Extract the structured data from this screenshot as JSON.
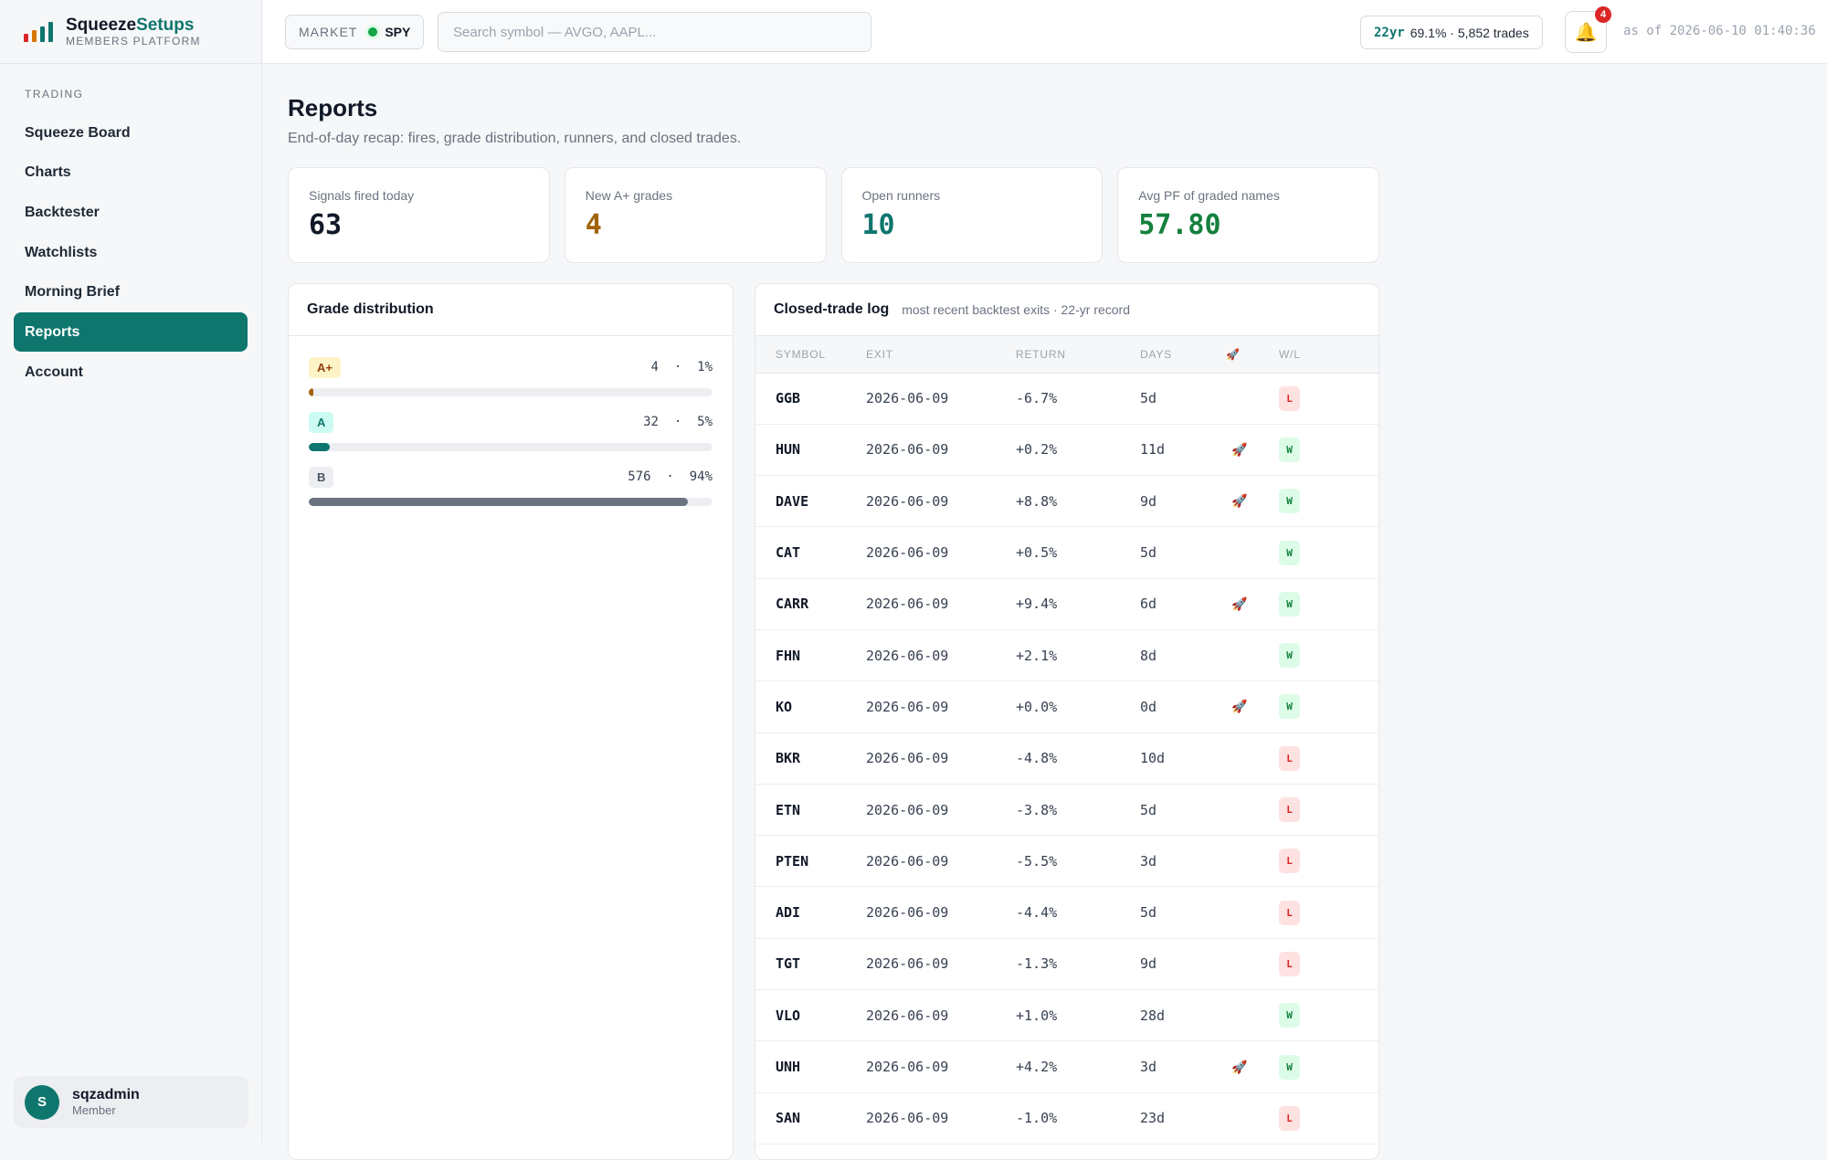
{
  "brand": {
    "name_part1": "Squeeze",
    "name_part2": "Setups",
    "subtitle": "MEMBERS PLATFORM",
    "logo_colors": [
      "#dc2626",
      "#d97706",
      "#0f766e",
      "#0f766e"
    ]
  },
  "sidebar": {
    "section_heading": "TRADING",
    "items": [
      {
        "label": "Squeeze Board",
        "active": false
      },
      {
        "label": "Charts",
        "active": false
      },
      {
        "label": "Backtester",
        "active": false
      },
      {
        "label": "Watchlists",
        "active": false
      },
      {
        "label": "Morning Brief",
        "active": false
      },
      {
        "label": "Reports",
        "active": true
      },
      {
        "label": "Account",
        "active": false
      }
    ],
    "user": {
      "initial": "S",
      "name": "sqzadmin",
      "role": "Member"
    }
  },
  "header": {
    "market_label": "MARKET",
    "market_symbol": "SPY",
    "search_placeholder": "Search symbol — AVGO, AAPL...",
    "record_years": "22yr",
    "record_stats": "69.1% · 5,852 trades",
    "bell_icon": "bell-icon",
    "notification_count": "4",
    "as_of": "as of 2026-06-10 01:40:36"
  },
  "page": {
    "title": "Reports",
    "subtitle": "End-of-day recap: fires, grade distribution, runners, and closed trades."
  },
  "kpis": [
    {
      "label": "Signals fired today",
      "value": "63",
      "color": "#111827"
    },
    {
      "label": "New A+ grades",
      "value": "4",
      "color": "#a16207"
    },
    {
      "label": "Open runners",
      "value": "10",
      "color": "#0f766e"
    },
    {
      "label": "Avg PF of graded names",
      "value": "57.80",
      "color": "#15803d"
    }
  ],
  "grades": {
    "title": "Grade distribution",
    "rows": [
      {
        "grade": "A+",
        "count": "4",
        "pct": "1%",
        "fraction": 0.012,
        "badge_bg": "#fef3c7",
        "badge_fg": "#92400e",
        "bar_color": "#a16207"
      },
      {
        "grade": "A",
        "count": "32",
        "pct": "5%",
        "fraction": 0.052,
        "badge_bg": "#ccfbf1",
        "badge_fg": "#0f766e",
        "bar_color": "#0f766e"
      },
      {
        "grade": "B",
        "count": "576",
        "pct": "94%",
        "fraction": 0.94,
        "badge_bg": "#eceef1",
        "badge_fg": "#4b5563",
        "bar_color": "#6b7280"
      }
    ]
  },
  "trades": {
    "title": "Closed-trade log",
    "note": "most recent backtest exits · 22-yr record",
    "columns": [
      "SYMBOL",
      "EXIT",
      "RETURN",
      "DAYS",
      "rocket-icon",
      "W/L"
    ],
    "rows": [
      {
        "symbol": "GGB",
        "exit": "2026-06-09",
        "ret": "-6.7%",
        "days": "5d",
        "rocket": "",
        "wl": "L"
      },
      {
        "symbol": "HUN",
        "exit": "2026-06-09",
        "ret": "+0.2%",
        "days": "11d",
        "rocket": "🚀",
        "wl": "W"
      },
      {
        "symbol": "DAVE",
        "exit": "2026-06-09",
        "ret": "+8.8%",
        "days": "9d",
        "rocket": "🚀",
        "wl": "W"
      },
      {
        "symbol": "CAT",
        "exit": "2026-06-09",
        "ret": "+0.5%",
        "days": "5d",
        "rocket": "",
        "wl": "W"
      },
      {
        "symbol": "CARR",
        "exit": "2026-06-09",
        "ret": "+9.4%",
        "days": "6d",
        "rocket": "🚀",
        "wl": "W"
      },
      {
        "symbol": "FHN",
        "exit": "2026-06-09",
        "ret": "+2.1%",
        "days": "8d",
        "rocket": "",
        "wl": "W"
      },
      {
        "symbol": "KO",
        "exit": "2026-06-09",
        "ret": "+0.0%",
        "days": "0d",
        "rocket": "🚀",
        "wl": "W"
      },
      {
        "symbol": "BKR",
        "exit": "2026-06-09",
        "ret": "-4.8%",
        "days": "10d",
        "rocket": "",
        "wl": "L"
      },
      {
        "symbol": "ETN",
        "exit": "2026-06-09",
        "ret": "-3.8%",
        "days": "5d",
        "rocket": "",
        "wl": "L"
      },
      {
        "symbol": "PTEN",
        "exit": "2026-06-09",
        "ret": "-5.5%",
        "days": "3d",
        "rocket": "",
        "wl": "L"
      },
      {
        "symbol": "ADI",
        "exit": "2026-06-09",
        "ret": "-4.4%",
        "days": "5d",
        "rocket": "",
        "wl": "L"
      },
      {
        "symbol": "TGT",
        "exit": "2026-06-09",
        "ret": "-1.3%",
        "days": "9d",
        "rocket": "",
        "wl": "L"
      },
      {
        "symbol": "VLO",
        "exit": "2026-06-09",
        "ret": "+1.0%",
        "days": "28d",
        "rocket": "",
        "wl": "W"
      },
      {
        "symbol": "UNH",
        "exit": "2026-06-09",
        "ret": "+4.2%",
        "days": "3d",
        "rocket": "🚀",
        "wl": "W"
      },
      {
        "symbol": "SAN",
        "exit": "2026-06-09",
        "ret": "-1.0%",
        "days": "23d",
        "rocket": "",
        "wl": "L"
      }
    ]
  }
}
